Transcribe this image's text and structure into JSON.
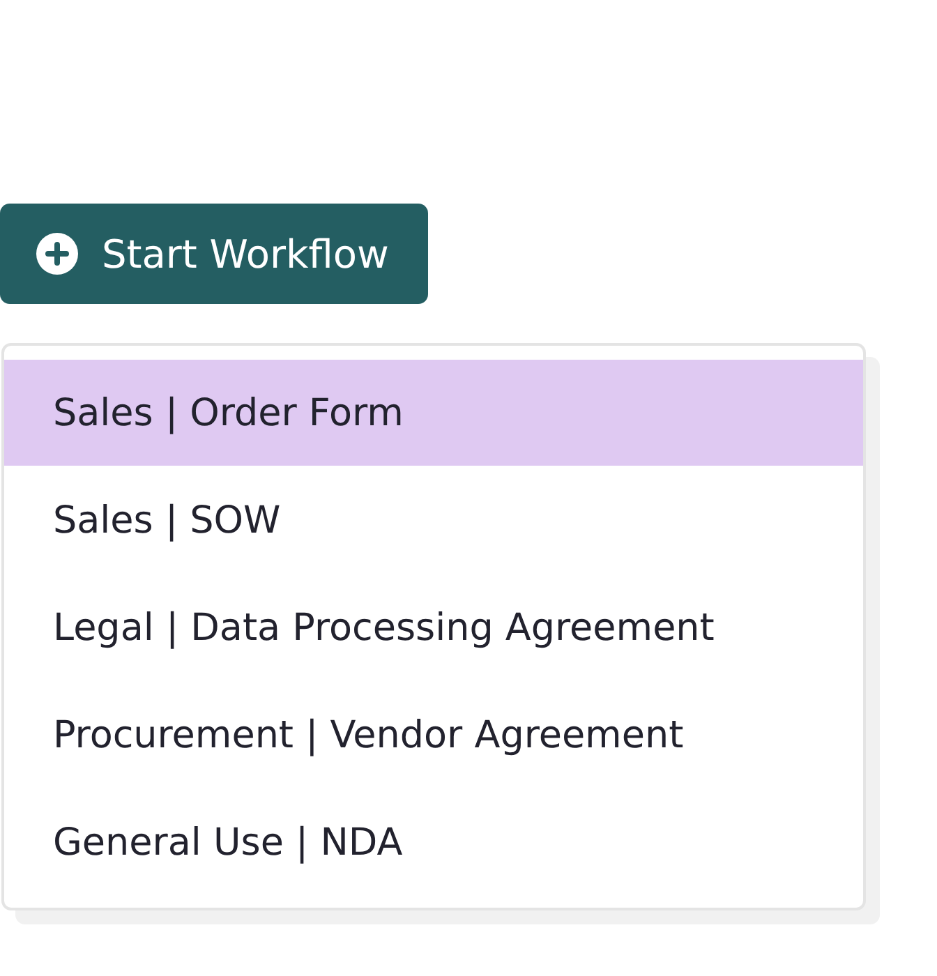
{
  "button": {
    "label": "Start Workflow"
  },
  "menu": {
    "items": [
      {
        "label": "Sales | Order Form",
        "selected": true
      },
      {
        "label": "Sales | SOW",
        "selected": false
      },
      {
        "label": "Legal | Data Processing Agreement",
        "selected": false
      },
      {
        "label": "Procurement | Vendor Agreement",
        "selected": false
      },
      {
        "label": "General Use | NDA",
        "selected": false
      }
    ]
  }
}
